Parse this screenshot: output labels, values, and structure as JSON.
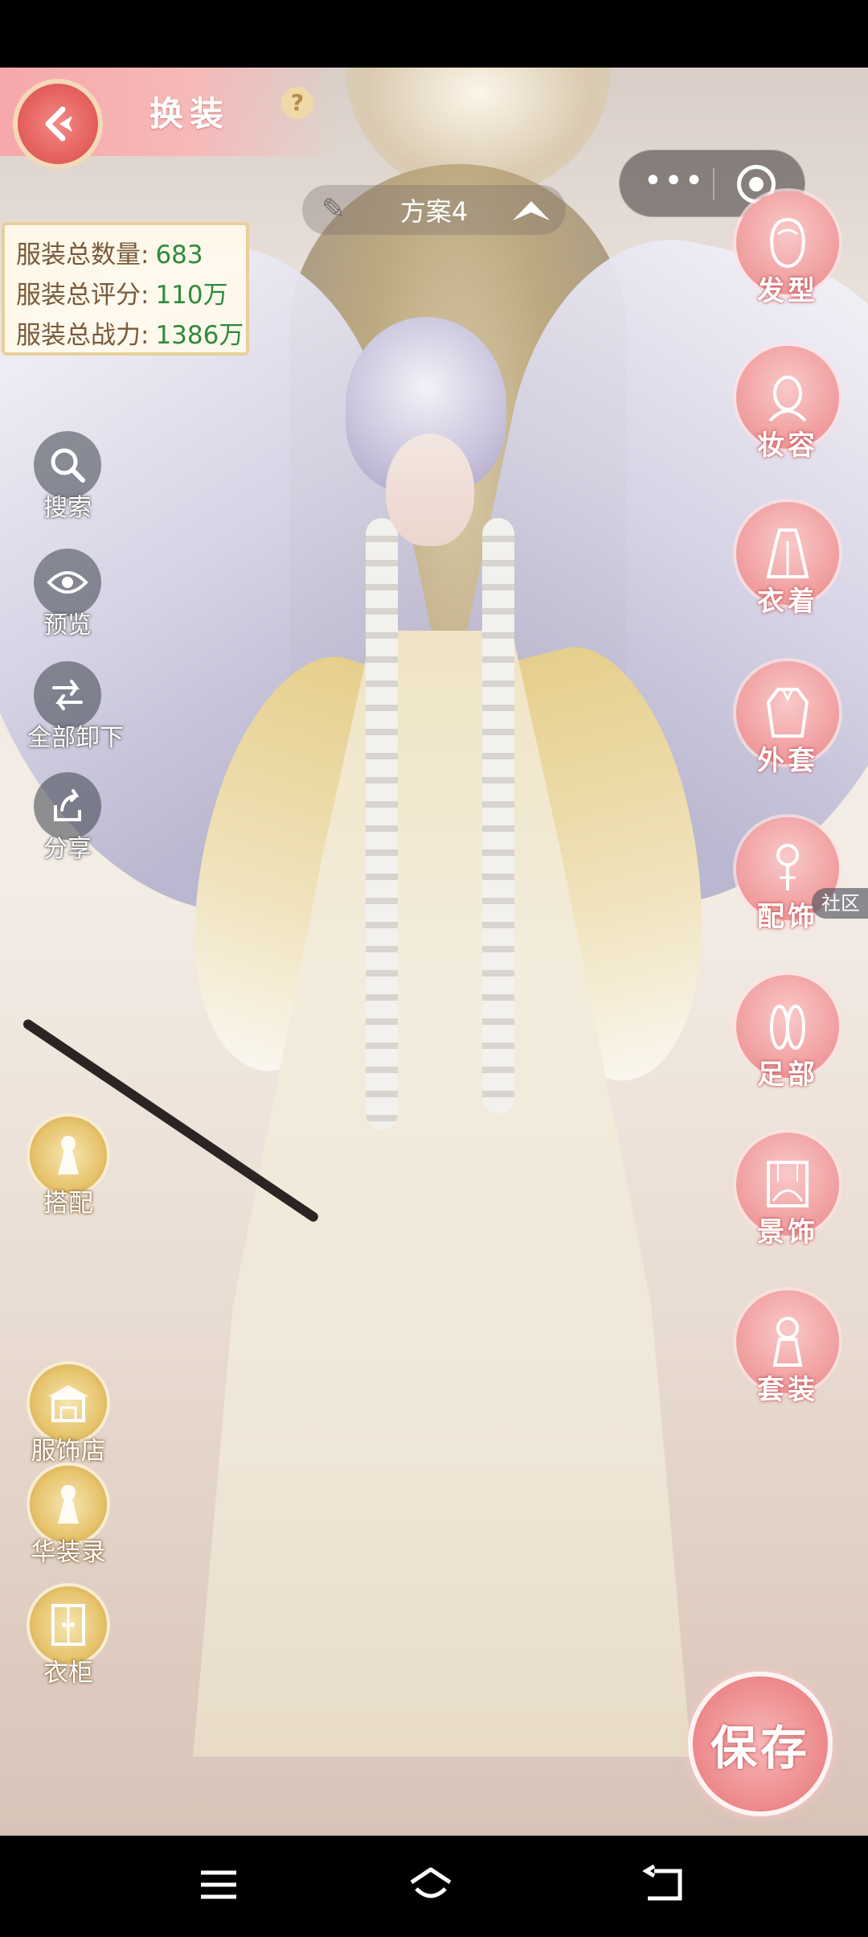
{
  "header": {
    "title": "换装",
    "help_label": "?"
  },
  "scheme": {
    "label": "方案4"
  },
  "stats": [
    {
      "label": "服装总数量:",
      "value": "683"
    },
    {
      "label": "服装总评分:",
      "value": "110万"
    },
    {
      "label": "服装总战力:",
      "value": "1386万"
    }
  ],
  "left_tools": [
    {
      "label": "搜索",
      "icon": "search-icon"
    },
    {
      "label": "预览",
      "icon": "eye-icon"
    },
    {
      "label": "全部卸下",
      "icon": "unequip-all-icon"
    },
    {
      "label": "分享",
      "icon": "share-icon"
    }
  ],
  "gold_buttons": [
    {
      "label": "搭配",
      "icon": "outfit-match-icon"
    },
    {
      "label": "服饰店",
      "icon": "shop-icon"
    },
    {
      "label": "华装录",
      "icon": "collection-book-icon"
    },
    {
      "label": "衣柜",
      "icon": "wardrobe-icon"
    }
  ],
  "categories": [
    {
      "label": "发型",
      "icon": "hairstyle-icon"
    },
    {
      "label": "妆容",
      "icon": "makeup-icon"
    },
    {
      "label": "衣着",
      "icon": "clothing-icon"
    },
    {
      "label": "外套",
      "icon": "coat-icon"
    },
    {
      "label": "配饰",
      "icon": "accessory-icon"
    },
    {
      "label": "足部",
      "icon": "shoes-icon"
    },
    {
      "label": "景饰",
      "icon": "scenery-icon"
    },
    {
      "label": "套装",
      "icon": "suit-icon"
    }
  ],
  "community_label": "社区",
  "save_label": "保存",
  "colors": {
    "accent_pink": "#f2a5a6",
    "gold": "#e7c46d",
    "stat_value_green": "#2f8a3c"
  }
}
